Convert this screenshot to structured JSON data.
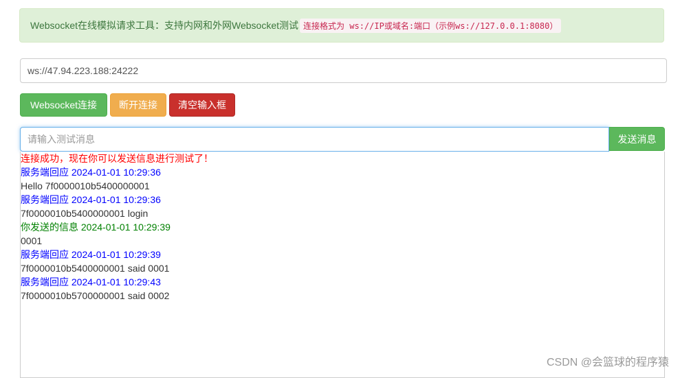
{
  "header": {
    "title": "Websocket在线模拟请求工具：支持内网和外网Websocket测试",
    "format_prefix": "连接格式为",
    "format_code": "ws://IP或域名:端口（示例ws://127.0.0.1:8080）"
  },
  "url_input": {
    "value": "ws://47.94.223.188:24222"
  },
  "buttons": {
    "connect": "Websocket连接",
    "disconnect": "断开连接",
    "clear": "清空输入框",
    "send": "发送消息"
  },
  "message_input": {
    "placeholder": "请输入测试消息",
    "value": ""
  },
  "log": [
    {
      "text": "连接成功，现在你可以发送信息进行测试了！",
      "kind": "status"
    },
    {
      "text": "服务端回应 2024-01-01 10:29:36",
      "kind": "server"
    },
    {
      "text": "Hello 7f0000010b5400000001",
      "kind": "content"
    },
    {
      "text": "服务端回应 2024-01-01 10:29:36",
      "kind": "server"
    },
    {
      "text": "7f0000010b5400000001 login",
      "kind": "content"
    },
    {
      "text": "你发送的信息 2024-01-01 10:29:39",
      "kind": "sent"
    },
    {
      "text": "0001",
      "kind": "content"
    },
    {
      "text": "服务端回应 2024-01-01 10:29:39",
      "kind": "server"
    },
    {
      "text": "7f0000010b5400000001 said 0001",
      "kind": "content"
    },
    {
      "text": "服务端回应 2024-01-01 10:29:43",
      "kind": "server"
    },
    {
      "text": "7f0000010b5700000001 said 0002",
      "kind": "content"
    }
  ],
  "watermark": "CSDN @会篮球的程序猿",
  "colors": {
    "status": "#ff0000",
    "server": "#0000ff",
    "sent": "#008000",
    "content": "#333333"
  }
}
